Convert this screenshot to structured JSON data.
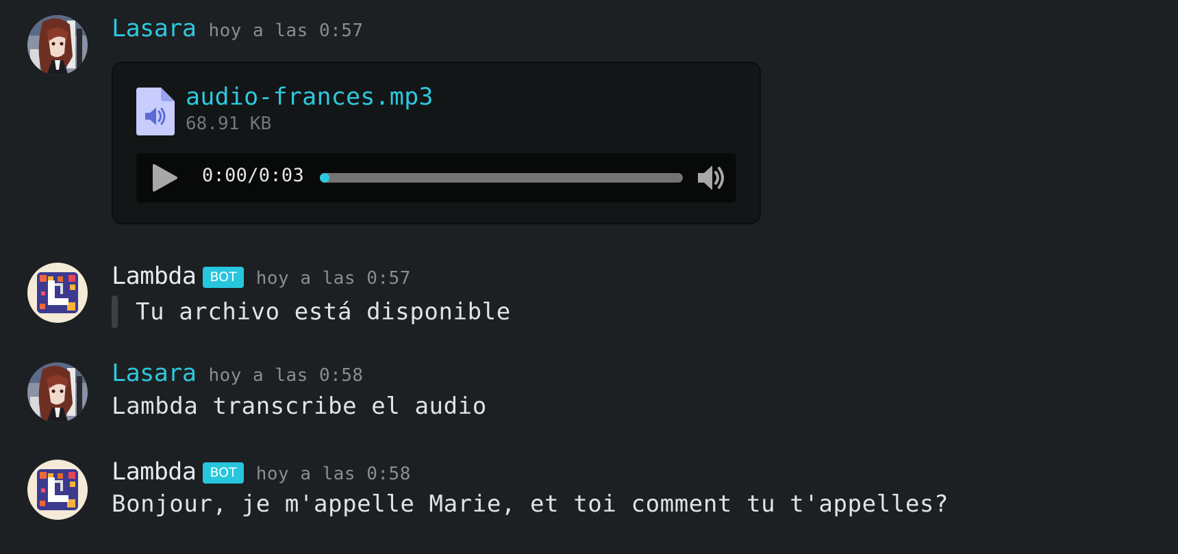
{
  "messages": [
    {
      "author": "Lasara",
      "timestamp": "hoy a las 0:57",
      "attachment": {
        "file_name": "audio-frances.mp3",
        "file_size": "68.91 KB",
        "player": {
          "current_time": "0:00",
          "separator": "/",
          "duration": "0:03",
          "progress_fraction": 0.0
        }
      }
    },
    {
      "author": "Lambda",
      "badge": "BOT",
      "timestamp": "hoy a las 0:57",
      "quote_text": "Tu archivo está disponible"
    },
    {
      "author": "Lasara",
      "timestamp": "hoy a las 0:58",
      "text": "Lambda transcribe el audio"
    },
    {
      "author": "Lambda",
      "badge": "BOT",
      "timestamp": "hoy a las 0:58",
      "text": "Bonjour, je m'appelle Marie, et toi comment tu t'appelles?"
    }
  ],
  "colors": {
    "background": "#1d2022",
    "accent": "#2ec8de",
    "bot_badge": "#28c6dd",
    "file_icon": "#c8cdfd",
    "file_icon_glyph": "#5a6bd6"
  },
  "icons": {
    "file": "audio-file-icon",
    "play": "play-icon",
    "volume": "volume-icon"
  }
}
